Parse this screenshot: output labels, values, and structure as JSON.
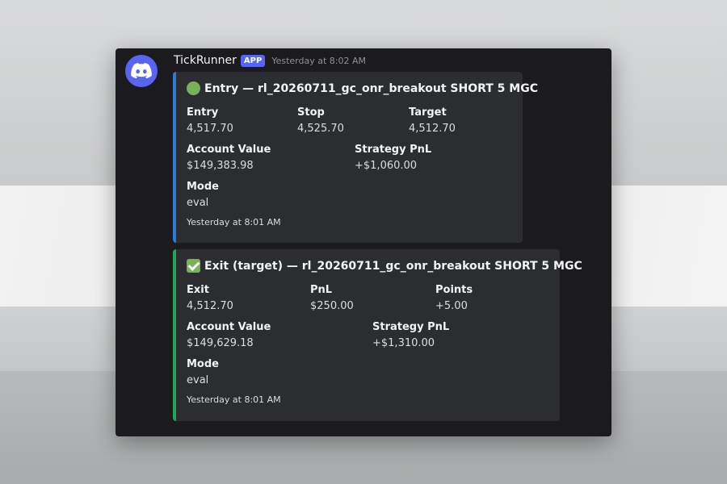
{
  "colors": {
    "window_bg": "#1b1b1e",
    "embed_bg": "#2b2d31",
    "entry_accent": "#2d7bd6",
    "exit_accent": "#23a55a",
    "app_badge": "#5865f2"
  },
  "message": {
    "avatar_icon": "discord-logo-icon",
    "username": "TickRunner",
    "app_badge": "APP",
    "timestamp": "Yesterday at 8:02 AM"
  },
  "embeds": [
    {
      "icon": "green-circle-icon",
      "title": "Entry — rl_20260711_gc_onr_breakout SHORT 5 MGC",
      "fields": [
        {
          "name": "Entry",
          "value": "4,517.70"
        },
        {
          "name": "Stop",
          "value": "4,525.70"
        },
        {
          "name": "Target",
          "value": "4,512.70"
        },
        {
          "name": "Account Value",
          "value": "$149,383.98"
        },
        {
          "name": "Strategy PnL",
          "value": "+$1,060.00"
        },
        {
          "name": "Mode",
          "value": "eval"
        }
      ],
      "footer": "Yesterday at 8:01 AM"
    },
    {
      "icon": "check-mark-icon",
      "title": "Exit (target) — rl_20260711_gc_onr_breakout SHORT 5 MGC",
      "fields": [
        {
          "name": "Exit",
          "value": "4,512.70"
        },
        {
          "name": "PnL",
          "value": "$250.00"
        },
        {
          "name": "Points",
          "value": "+5.00"
        },
        {
          "name": "Account Value",
          "value": "$149,629.18"
        },
        {
          "name": "Strategy PnL",
          "value": "+$1,310.00"
        },
        {
          "name": "Mode",
          "value": "eval"
        }
      ],
      "footer": "Yesterday at 8:01 AM"
    }
  ]
}
